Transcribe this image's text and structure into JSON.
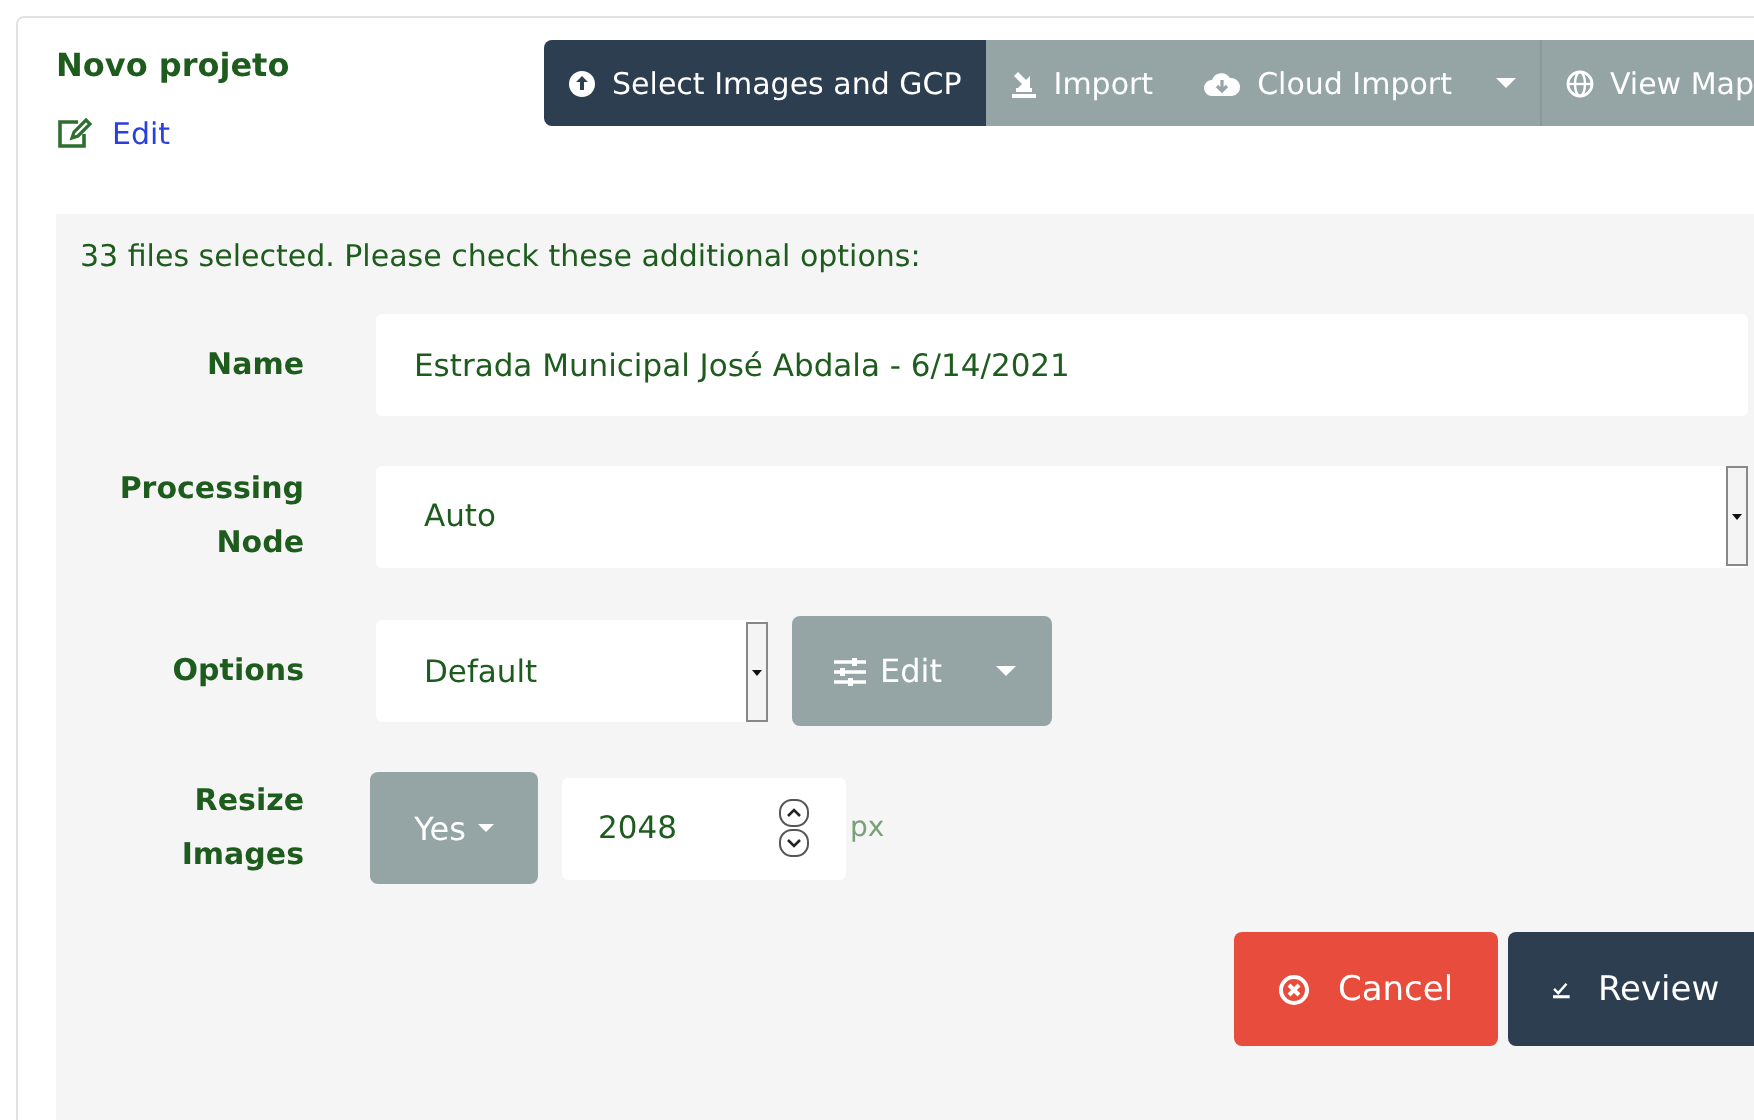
{
  "project": {
    "title": "Novo projeto",
    "edit_link": "Edit"
  },
  "toolbar": [
    {
      "label": "Select Images and GCP",
      "kind": "primary",
      "dropdown": false
    },
    {
      "label": "Import",
      "kind": "default",
      "dropdown": false
    },
    {
      "label": "Cloud Import",
      "kind": "default",
      "dropdown": true
    },
    {
      "label": "View Map",
      "kind": "default",
      "dropdown": false
    }
  ],
  "panel": {
    "message": "33 files selected. Please check these additional options:",
    "name": {
      "label": "Name",
      "value": "Estrada Municipal José Abdala - 6/14/2021"
    },
    "processing_node": {
      "label": "Processing Node",
      "value": "Auto"
    },
    "options": {
      "label": "Options",
      "value": "Default",
      "edit_button": "Edit"
    },
    "resize_images": {
      "label": "Resize Images",
      "toggle": "Yes",
      "value": "2048",
      "unit": "px"
    },
    "buttons": [
      {
        "label": "Cancel",
        "kind": "danger"
      },
      {
        "label": "Review",
        "kind": "primary"
      }
    ]
  }
}
